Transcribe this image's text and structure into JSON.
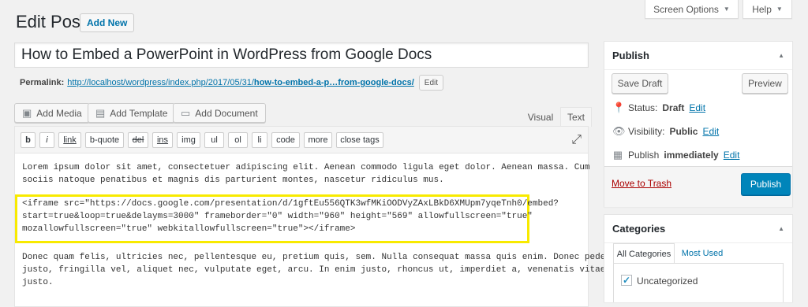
{
  "screen_options": {
    "label": "Screen Options",
    "caret": "▼"
  },
  "help": {
    "label": "Help",
    "caret": "▼"
  },
  "page": {
    "heading": "Edit Post",
    "add_new": "Add New"
  },
  "post": {
    "title": "How to Embed a PowerPoint in WordPress from Google Docs"
  },
  "permalink": {
    "label": "Permalink:",
    "url_base": "http://localhost/wordpress/index.php/2017/05/31/",
    "slug": "how-to-embed-a-p…from-google-docs/",
    "edit": "Edit"
  },
  "media_buttons": [
    {
      "icon": "media-icon",
      "glyph": "▣",
      "label": "Add Media"
    },
    {
      "icon": "template-icon",
      "glyph": "▤",
      "label": "Add Template"
    },
    {
      "icon": "document-icon",
      "glyph": "▭",
      "label": "Add Document"
    }
  ],
  "editor_tabs": {
    "visual": "Visual",
    "text": "Text"
  },
  "quicktags": [
    "b",
    "i",
    "link",
    "b-quote",
    "del",
    "ins",
    "img",
    "ul",
    "ol",
    "li",
    "code",
    "more",
    "close tags"
  ],
  "content": {
    "para1": [
      "Lorem ipsum dolor sit amet, consectetuer adipiscing elit. Aenean commodo ligula eget dolor. Aenean massa. Cum",
      "sociis natoque penatibus et magnis dis parturient montes, nascetur ridiculus mus."
    ],
    "iframe": [
      "<iframe src=\"https://docs.google.com/presentation/d/1gftEu556QTK3wfMKiOODVyZAxLBkD6XMUpm7yqeTnh0/embed?",
      "start=true&loop=true&delayms=3000\" frameborder=\"0\" width=\"960\" height=\"569\" allowfullscreen=\"true\"",
      "mozallowfullscreen=\"true\" webkitallowfullscreen=\"true\"></iframe>"
    ],
    "para2": [
      "Donec quam felis, ultricies nec, pellentesque eu, pretium quis, sem. Nulla consequat massa quis enim. Donec pede",
      "justo, fringilla vel, aliquet nec, vulputate eget, arcu. In enim justo, rhoncus ut, imperdiet a, venenatis vitae,",
      "justo."
    ]
  },
  "publish_box": {
    "title": "Publish",
    "save_draft": "Save Draft",
    "preview": "Preview",
    "status_label": "Status:",
    "status_value": "Draft",
    "visibility_label": "Visibility:",
    "visibility_value": "Public",
    "publish_label": "Publish",
    "publish_value": "immediately",
    "edit": "Edit",
    "trash": "Move to Trash",
    "publish_button": "Publish"
  },
  "categories_box": {
    "title": "Categories",
    "tabs": [
      "All Categories",
      "Most Used"
    ],
    "items": [
      {
        "label": "Uncategorized",
        "checked": true
      }
    ]
  },
  "colors": {
    "accent": "#0073aa",
    "primary_button": "#0085ba",
    "highlight": "#f8ea00",
    "trash": "#a00"
  }
}
